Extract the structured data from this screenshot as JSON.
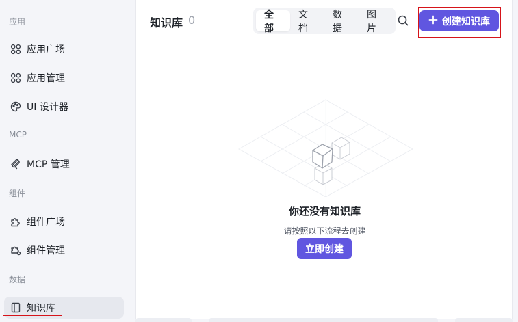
{
  "sidebar": {
    "groups": [
      {
        "label": "应用"
      },
      {
        "label": "MCP"
      },
      {
        "label": "组件"
      },
      {
        "label": "数据"
      }
    ],
    "items": [
      {
        "label": "应用广场",
        "icon": "apps-icon"
      },
      {
        "label": "应用管理",
        "icon": "apps-icon"
      },
      {
        "label": "UI 设计器",
        "icon": "palette-icon"
      },
      {
        "label": "MCP 管理",
        "icon": "mcp-icon"
      },
      {
        "label": "组件广场",
        "icon": "puzzle-icon"
      },
      {
        "label": "组件管理",
        "icon": "puzzle-gear-icon"
      },
      {
        "label": "知识库",
        "icon": "book-icon",
        "active": true
      }
    ]
  },
  "header": {
    "title": "知识库",
    "count": "0",
    "tabs": [
      {
        "label": "全部",
        "active": true
      },
      {
        "label": "文档"
      },
      {
        "label": "数据"
      },
      {
        "label": "图片"
      }
    ],
    "create_label": "创建知识库"
  },
  "empty": {
    "title": "你还没有知识库",
    "desc": "请按照以下流程去创建",
    "button": "立即创建"
  },
  "colors": {
    "accent": "#6056e0",
    "highlight": "#d6141a"
  }
}
